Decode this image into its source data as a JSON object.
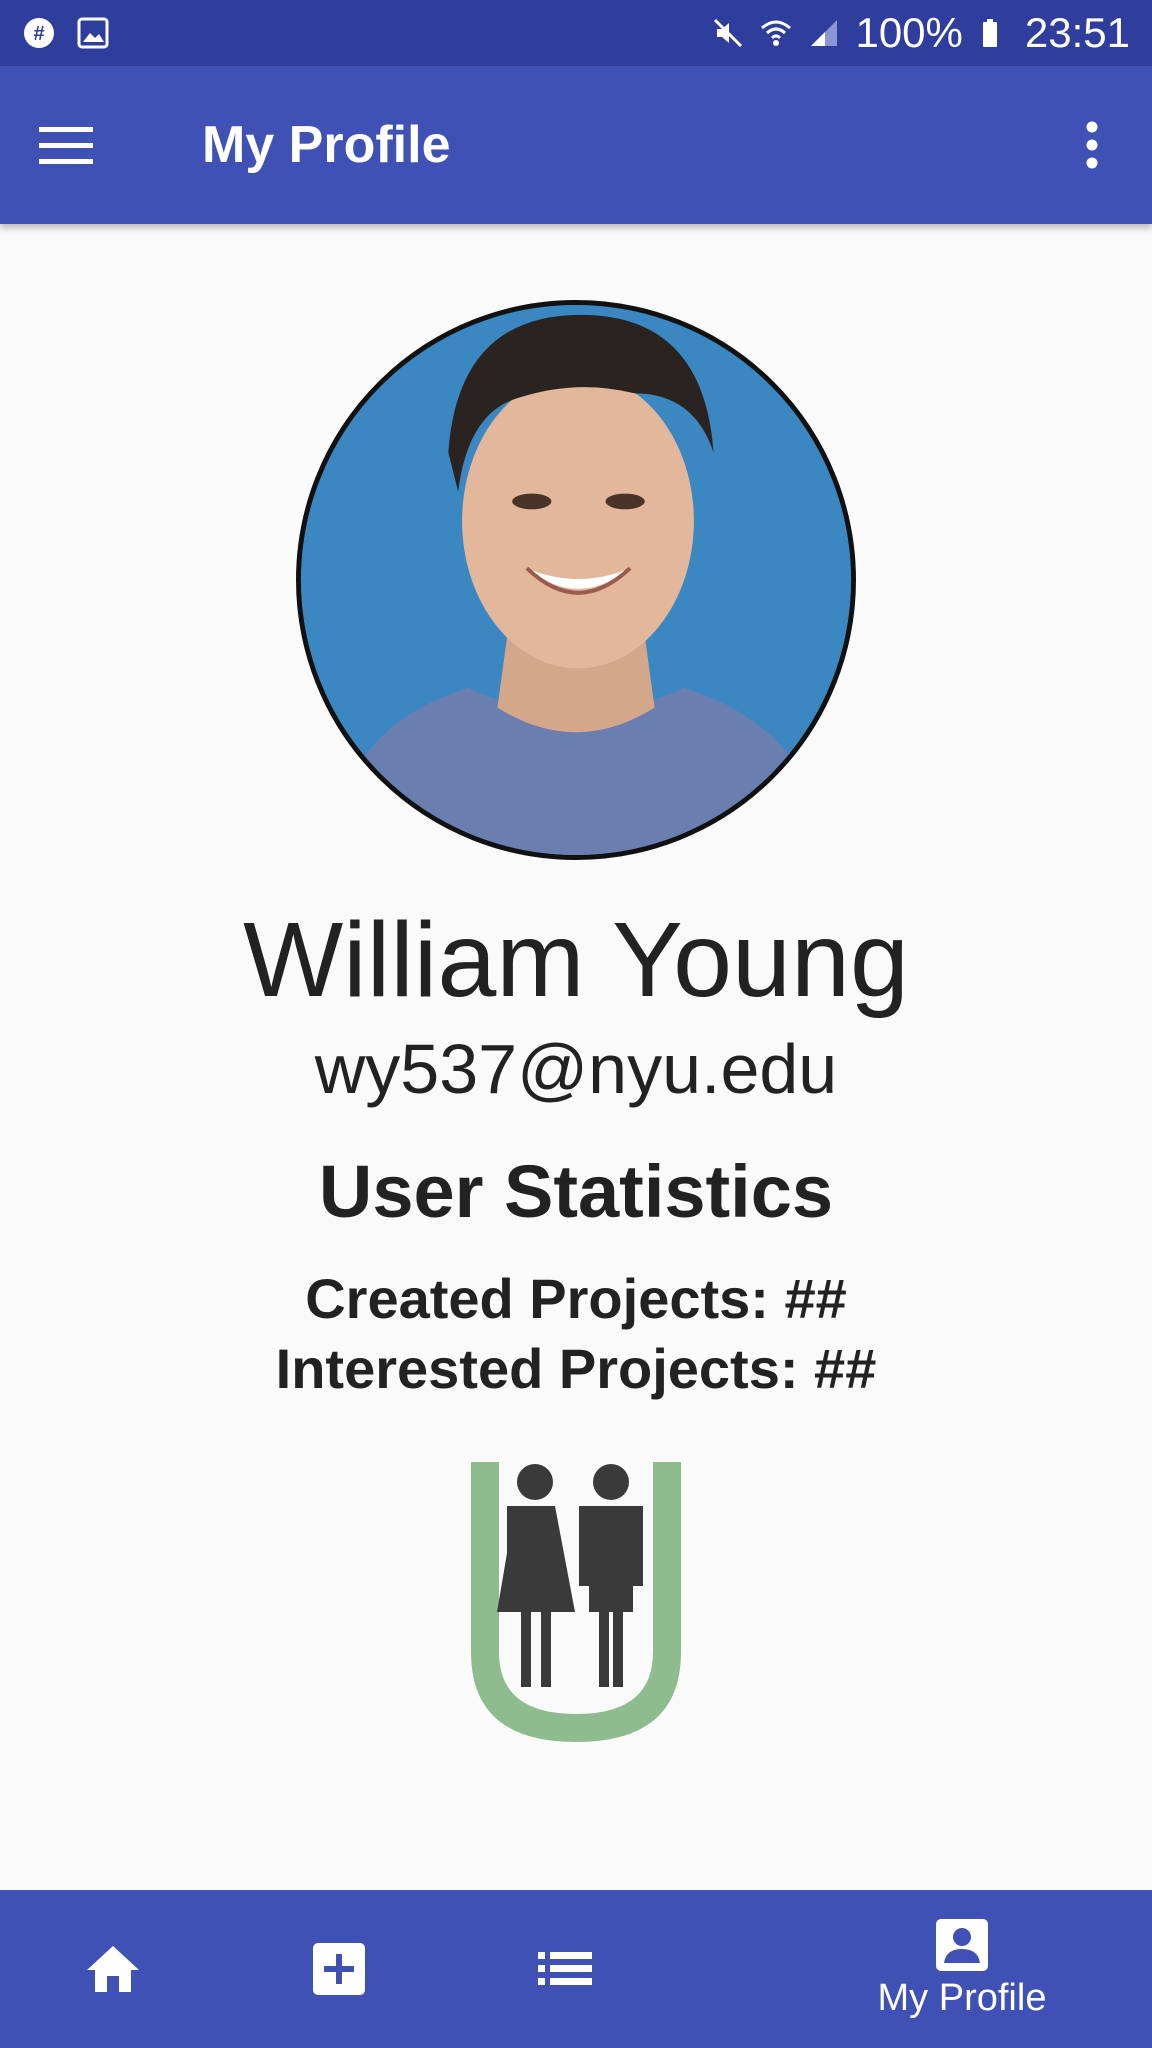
{
  "status_bar": {
    "left_icons": [
      "notification-icon",
      "image-icon"
    ],
    "battery": "100%",
    "time": "23:51"
  },
  "app_bar": {
    "title": "My Profile"
  },
  "profile": {
    "name": "William Young",
    "email": "wy537@nyu.edu"
  },
  "stats": {
    "title": "User Statistics",
    "created": "Created Projects: ##",
    "interested": "Interested Projects: ##"
  },
  "bottom_nav": {
    "items": [
      {
        "icon": "home-icon",
        "label": ""
      },
      {
        "icon": "add-icon",
        "label": ""
      },
      {
        "icon": "list-icon",
        "label": ""
      },
      {
        "icon": "profile-icon",
        "label": "My Profile"
      }
    ]
  },
  "colors": {
    "status_bar": "#2f3d9c",
    "primary": "#3f51b5",
    "logo_green": "#8fbc8f",
    "logo_figures": "#3a3a3a"
  }
}
